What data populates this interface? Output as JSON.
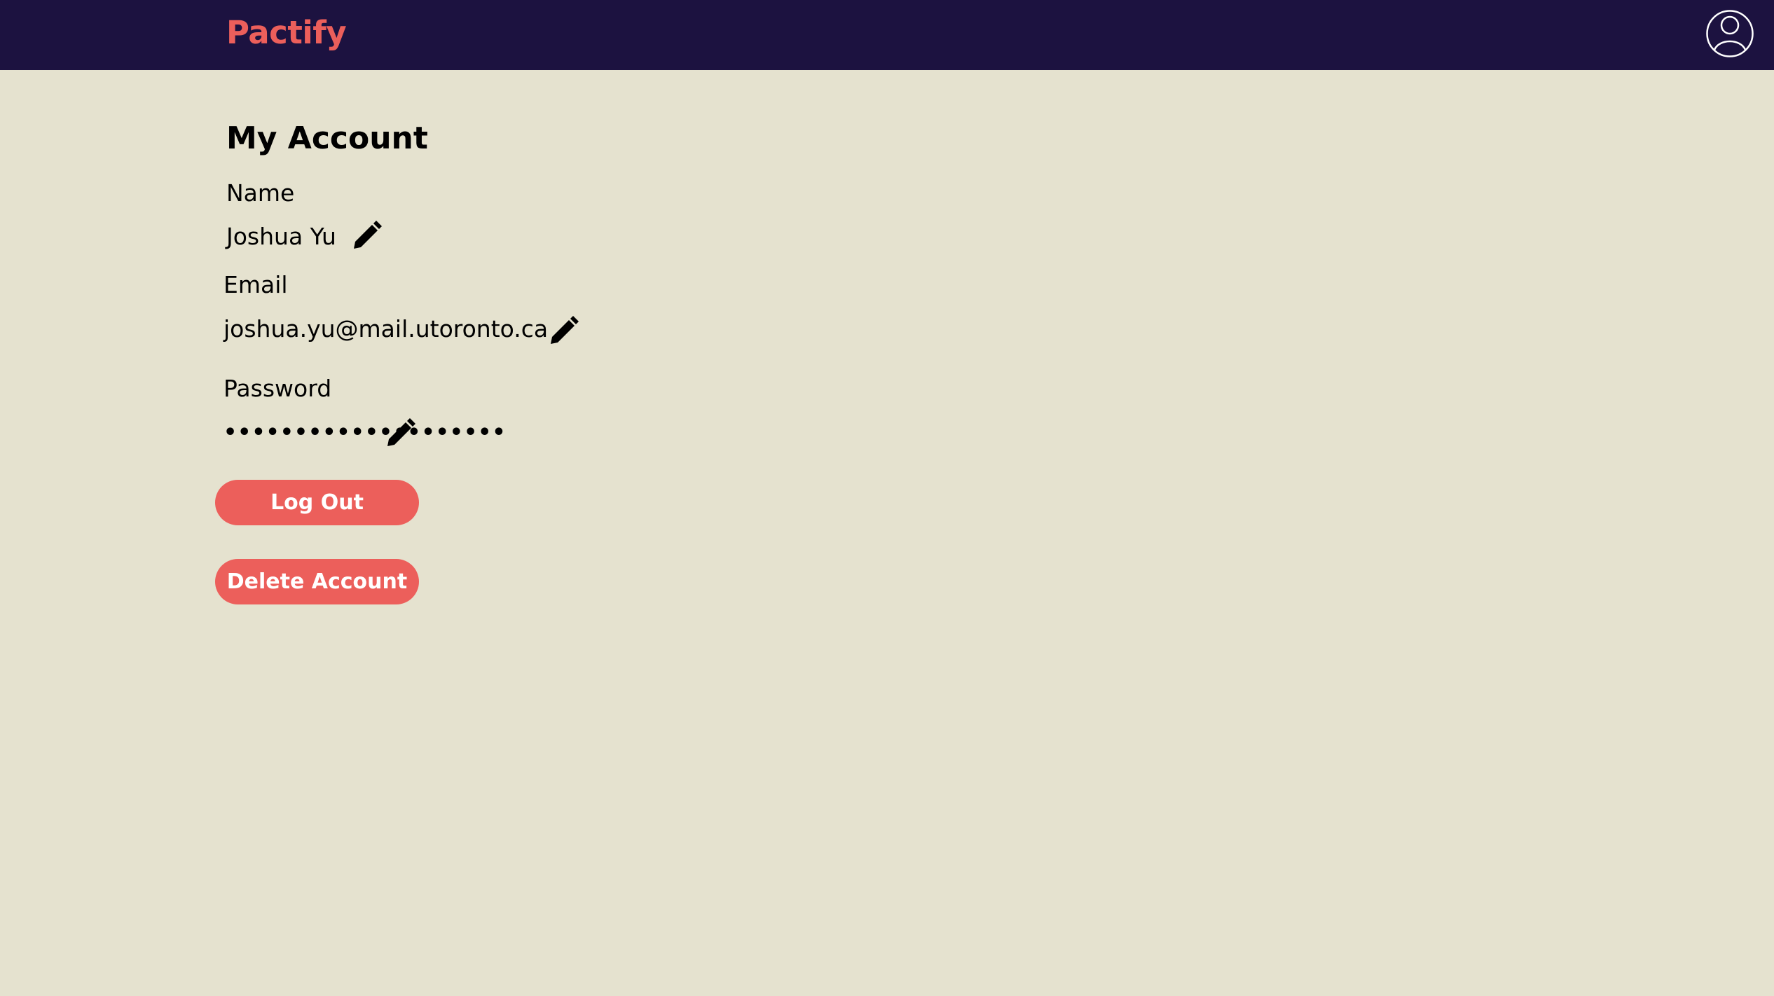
{
  "header": {
    "brand": "Pactify",
    "profile_icon": "user-circle-icon",
    "colors": {
      "background": "#1c1240",
      "brand": "#ec5f5b"
    }
  },
  "account": {
    "title": "My Account",
    "name_label": "Name",
    "name_value": "Joshua Yu",
    "email_label": "Email",
    "email_value": "joshua.yu@mail.utoronto.ca",
    "password_label": "Password",
    "password_value": "••••••••••••••••••••",
    "edit_icon": "pencil-icon"
  },
  "actions": {
    "logout_label": "Log Out",
    "delete_label": "Delete Account",
    "color": "#ec5f5b"
  },
  "page": {
    "background": "#e5e2cf"
  }
}
